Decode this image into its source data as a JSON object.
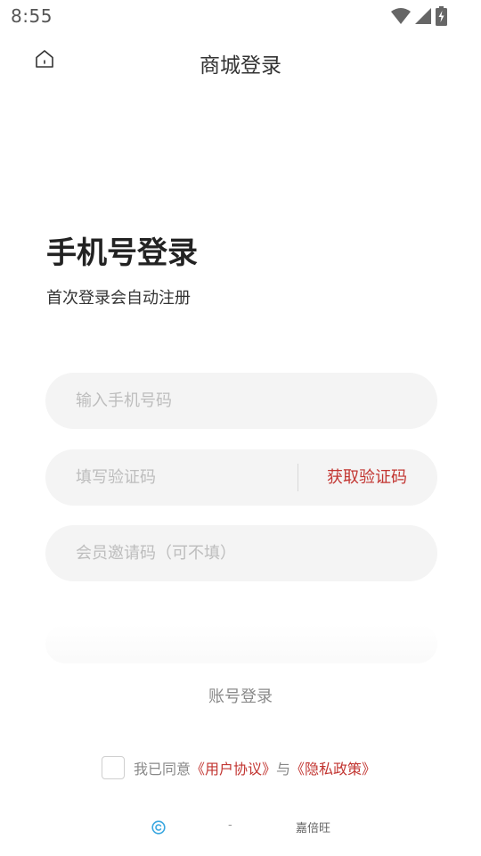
{
  "status_bar": {
    "time": "8:55",
    "icons": [
      "wifi-icon",
      "signal-icon",
      "battery-icon"
    ]
  },
  "header": {
    "title": "商城登录",
    "home_icon": "home-icon"
  },
  "main": {
    "heading": "手机号登录",
    "subheading": "首次登录会自动注册",
    "phone_placeholder": "输入手机号码",
    "code_placeholder": "填写验证码",
    "get_code_label": "获取验证码",
    "invite_placeholder": "会员邀请码（可不填）",
    "account_login_label": "账号登录"
  },
  "agreement": {
    "prefix": "我已同意",
    "user_agreement": "《用户协议》",
    "conjunction": "与",
    "privacy_policy": "《隐私政策》"
  },
  "footer": {
    "dash": "-",
    "company": "嘉倍旺"
  },
  "colors": {
    "accent": "#c23531",
    "field_bg": "#f4f4f4",
    "copyright_icon": "#3aa7e0"
  }
}
